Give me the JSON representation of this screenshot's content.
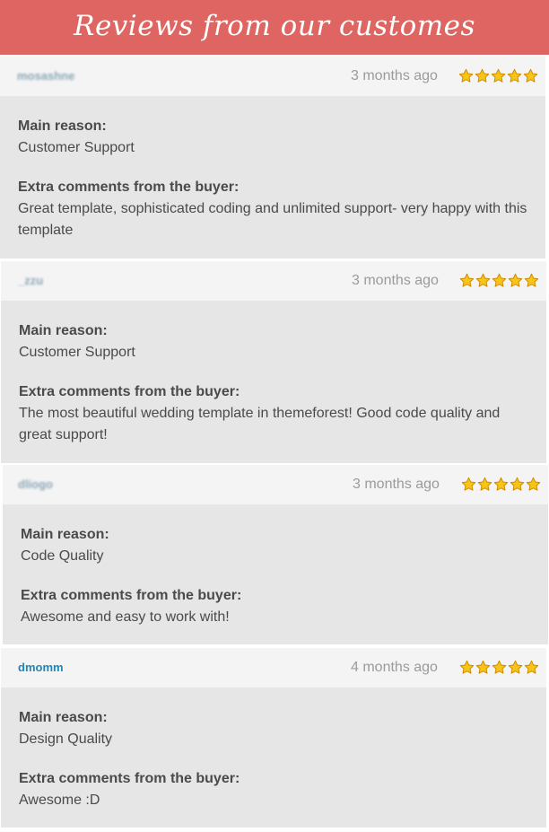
{
  "banner": {
    "title": "Reviews from our customes"
  },
  "labels": {
    "reason": "Main reason:",
    "comments": "Extra comments from the buyer:"
  },
  "colors": {
    "banner": "#de6561",
    "username": "#1f86b8",
    "star_fill": "#f5c518",
    "star_stroke": "#d08a00"
  },
  "rating_icon": "star-icon",
  "reviews": [
    {
      "user": "mosashne",
      "time": "3 months ago",
      "rating": 5,
      "reason": "Customer Support",
      "comment": "Great template, sophisticated coding and unlimited support- very happy with this template"
    },
    {
      "user": "_zzu",
      "time": "3 months ago",
      "rating": 5,
      "reason": "Customer Support",
      "comment": "The most beautiful wedding template in themeforest! Good code quality and great support!"
    },
    {
      "user": "dliogo",
      "time": "3 months ago",
      "rating": 5,
      "reason": "Code Quality",
      "comment": "Awesome and easy to work with!"
    },
    {
      "user": "dmomm",
      "time": "4 months ago",
      "rating": 5,
      "reason": "Design Quality",
      "comment": "Awesome :D"
    }
  ]
}
